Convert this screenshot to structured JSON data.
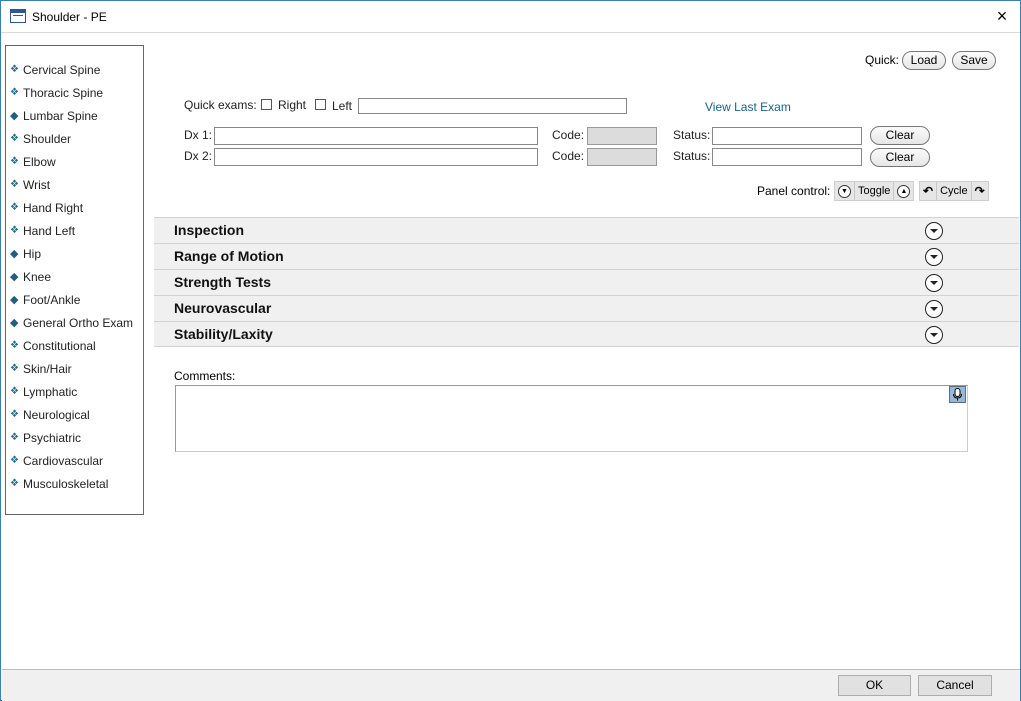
{
  "window": {
    "title": "Shoulder - PE",
    "close_glyph": "×"
  },
  "nav": {
    "items": [
      {
        "label": "Cervical Spine",
        "bullet": "❖"
      },
      {
        "label": "Thoracic Spine",
        "bullet": "❖"
      },
      {
        "label": "Lumbar Spine",
        "bullet": "◆"
      },
      {
        "label": "Shoulder",
        "bullet": "❖"
      },
      {
        "label": "Elbow",
        "bullet": "❖"
      },
      {
        "label": "Wrist",
        "bullet": "❖"
      },
      {
        "label": "Hand Right",
        "bullet": "❖"
      },
      {
        "label": "Hand Left",
        "bullet": "❖"
      },
      {
        "label": "Hip",
        "bullet": "◆"
      },
      {
        "label": "Knee",
        "bullet": "◆"
      },
      {
        "label": "Foot/Ankle",
        "bullet": "◆"
      },
      {
        "label": "General Ortho Exam",
        "bullet": "◆"
      },
      {
        "label": "Constitutional",
        "bullet": "❖"
      },
      {
        "label": "Skin/Hair",
        "bullet": "❖"
      },
      {
        "label": "Lymphatic",
        "bullet": "❖"
      },
      {
        "label": "Neurological",
        "bullet": "❖"
      },
      {
        "label": "Psychiatric",
        "bullet": "❖"
      },
      {
        "label": "Cardiovascular",
        "bullet": "❖"
      },
      {
        "label": "Musculoskeletal",
        "bullet": "❖"
      }
    ]
  },
  "quick": {
    "label": "Quick:",
    "load": "Load",
    "save": "Save"
  },
  "quick_exams": {
    "label": "Quick exams:",
    "right": "Right",
    "left": "Left",
    "text_value": "",
    "view_last": "View Last Exam"
  },
  "dx": [
    {
      "label": "Dx 1:",
      "value": "",
      "code_label": "Code:",
      "code": "",
      "status_label": "Status:",
      "status": "",
      "clear": "Clear"
    },
    {
      "label": "Dx 2:",
      "value": "",
      "code_label": "Code:",
      "code": "",
      "status_label": "Status:",
      "status": "",
      "clear": "Clear"
    }
  ],
  "panel_control": {
    "label": "Panel control:",
    "toggle": "Toggle",
    "cycle": "Cycle"
  },
  "sections": [
    "Inspection",
    "Range of Motion",
    "Strength Tests",
    "Neurovascular",
    "Stability/Laxity"
  ],
  "comments": {
    "label": "Comments:",
    "value": ""
  },
  "footer": {
    "ok": "OK",
    "cancel": "Cancel"
  },
  "icons": {
    "title": "form-window-icon",
    "close": "close-icon",
    "collapse": "chevron-down-circle-icon",
    "mic": "microphone-icon"
  },
  "colors": {
    "link": "#1a5f8a",
    "bullet": "#1f6f8b",
    "section_bg": "#f0f0f0"
  }
}
